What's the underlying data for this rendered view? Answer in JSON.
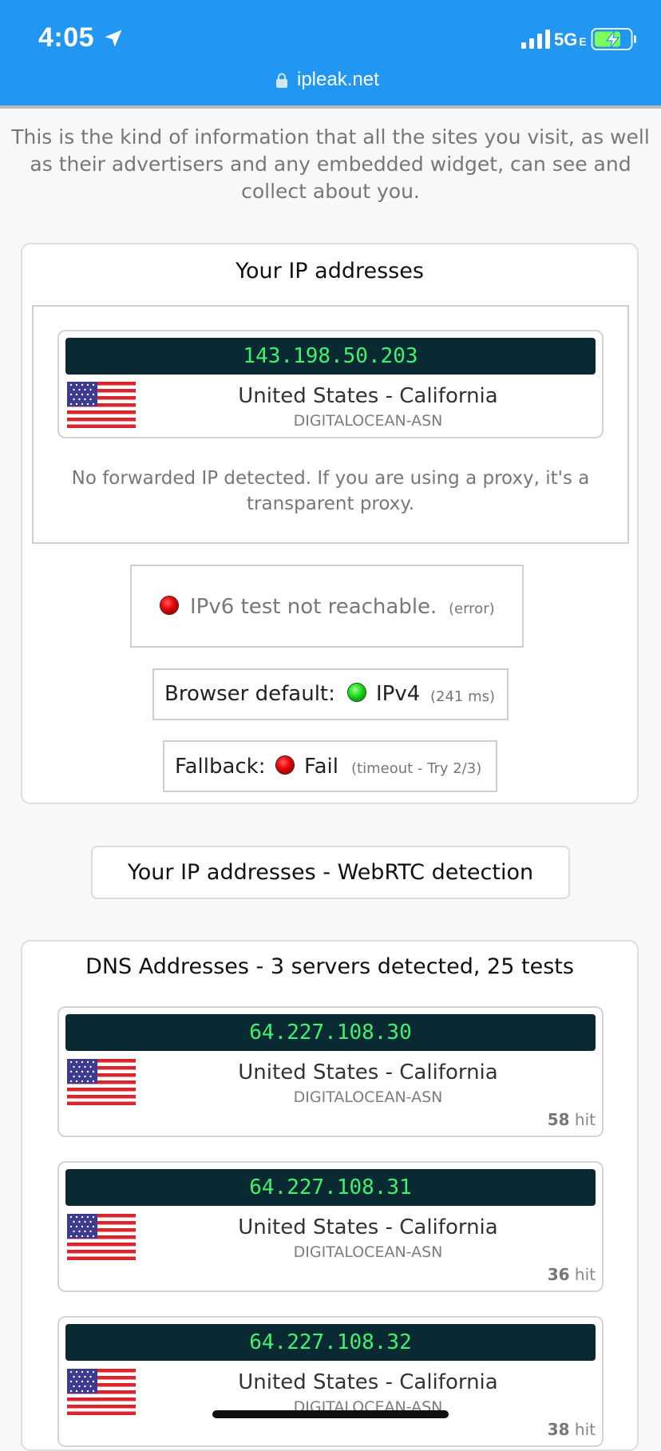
{
  "status_bar": {
    "time": "4:05",
    "network": "5G",
    "network_suffix": "E",
    "icons": [
      "location-arrow-icon",
      "signal-bars-icon",
      "battery-charging-icon"
    ]
  },
  "browser": {
    "url": "ipleak.net",
    "lock_icon": "lock-icon",
    "accent_color": "#2196f3"
  },
  "intro": "This is the kind of information that all the sites you visit, as well as their advertisers and any embedded widget, can see and collect about you.",
  "ip_section": {
    "title": "Your IP addresses",
    "ip": {
      "address": "143.198.50.203",
      "location": "United States - California",
      "asn": "DIGITALOCEAN-ASN",
      "flag": "us-flag-icon"
    },
    "forward_note": "No forwarded IP detected. If you are using a proxy, it's a transparent proxy.",
    "ipv6": {
      "status": "red",
      "text": "IPv6 test not reachable.",
      "detail": "(error)"
    },
    "browser_default": {
      "label": "Browser default:",
      "status": "green",
      "value": "IPv4",
      "detail": "(241 ms)"
    },
    "fallback": {
      "label": "Fallback:",
      "status": "red",
      "value": "Fail",
      "detail": "(timeout - Try 2/3)"
    }
  },
  "webrtc_button": "Your IP addresses - WebRTC detection",
  "dns_section": {
    "title": "DNS Addresses - 3 servers detected, 25 tests",
    "servers": [
      {
        "address": "64.227.108.30",
        "location": "United States - California",
        "asn": "DIGITALOCEAN-ASN",
        "hits": "58",
        "hit_label": "hit"
      },
      {
        "address": "64.227.108.31",
        "location": "United States - California",
        "asn": "DIGITALOCEAN-ASN",
        "hits": "36",
        "hit_label": "hit"
      },
      {
        "address": "64.227.108.32",
        "location": "United States - California",
        "asn": "DIGITALOCEAN-ASN",
        "hits": "38",
        "hit_label": "hit"
      }
    ]
  },
  "colors": {
    "ip_bar_bg": "#092a33",
    "ip_text": "#3ff26e",
    "status_red": "#e00000",
    "status_green": "#19d619"
  }
}
